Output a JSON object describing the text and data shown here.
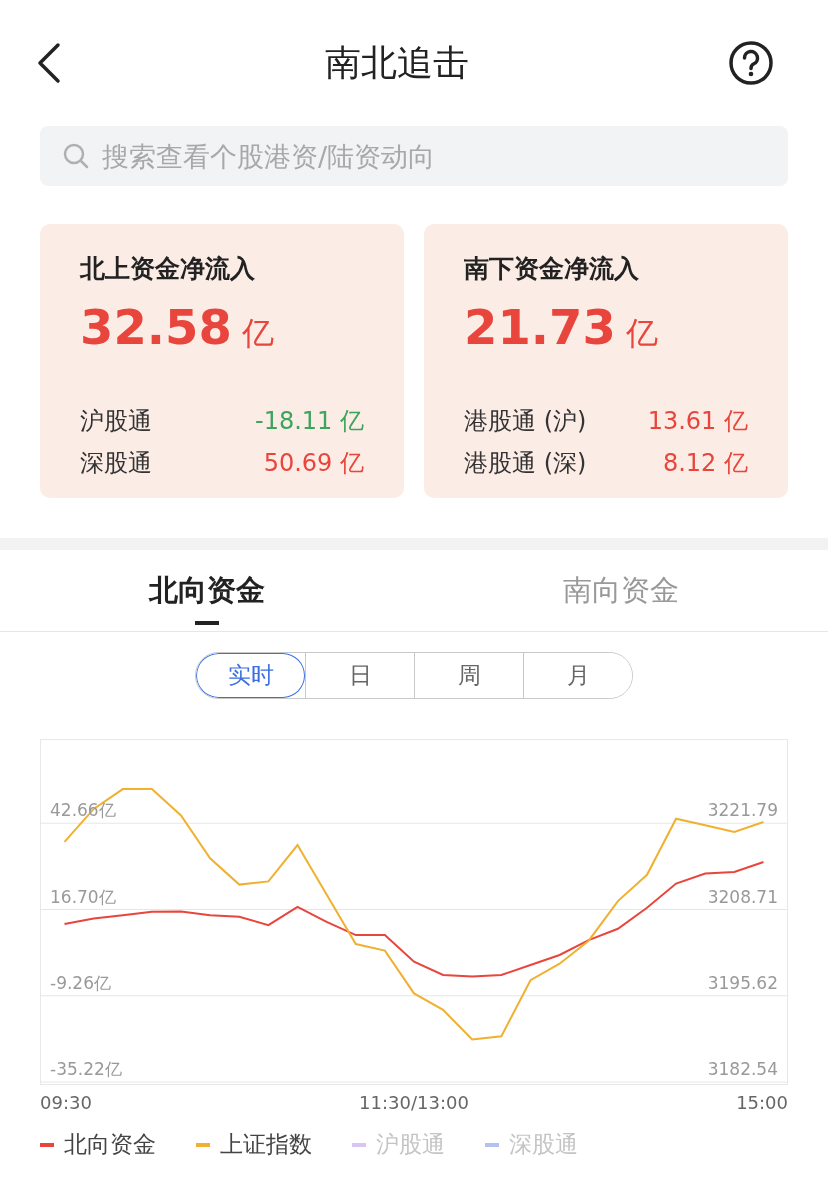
{
  "header": {
    "title": "南北追击"
  },
  "search": {
    "placeholder": "搜索查看个股港资/陆资动向"
  },
  "cards": [
    {
      "title": "北上资金净流入",
      "amount": "32.58",
      "unit": "亿",
      "rows": [
        {
          "label": "沪股通",
          "value": "-18.11 亿",
          "color": "#3aa55b"
        },
        {
          "label": "深股通",
          "value": "50.69 亿",
          "color": "#e8453c"
        }
      ]
    },
    {
      "title": "南下资金净流入",
      "amount": "21.73",
      "unit": "亿",
      "rows": [
        {
          "label": "港股通 (沪)",
          "value": "13.61 亿",
          "color": "#e8453c"
        },
        {
          "label": "港股通 (深)",
          "value": "8.12 亿",
          "color": "#e8453c"
        }
      ]
    }
  ],
  "tabs": [
    {
      "label": "北向资金",
      "selected": true
    },
    {
      "label": "南向资金",
      "selected": false
    }
  ],
  "periods": [
    {
      "label": "实时",
      "selected": true
    },
    {
      "label": "日",
      "selected": false
    },
    {
      "label": "周",
      "selected": false
    },
    {
      "label": "月",
      "selected": false
    }
  ],
  "chart_data": {
    "type": "line",
    "categories": [
      "09:30",
      null,
      null,
      null,
      null,
      null,
      null,
      null,
      null,
      null,
      null,
      null,
      "11:30/13:00",
      null,
      null,
      null,
      null,
      null,
      null,
      null,
      null,
      null,
      null,
      null,
      "15:00"
    ],
    "ylim": [
      -36.1,
      68
    ],
    "yticks": [
      {
        "value": -35.22,
        "label": "-35.22亿"
      },
      {
        "value": -9.26,
        "label": "-9.26亿"
      },
      {
        "value": 16.7,
        "label": "16.70亿"
      },
      {
        "value": 42.66,
        "label": "42.66亿"
      }
    ],
    "y2lim": [
      3182.1,
      3234.6
    ],
    "y2ticks": [
      {
        "value": 3182.54,
        "label": "3182.54"
      },
      {
        "value": 3195.62,
        "label": "3195.62"
      },
      {
        "value": 3208.71,
        "label": "3208.71"
      },
      {
        "value": 3221.79,
        "label": "3221.79"
      }
    ],
    "series": [
      {
        "name": "北向资金",
        "color": "#e8453c",
        "values": [
          12.3,
          14,
          15,
          16,
          16.1,
          15,
          14.5,
          12,
          17.5,
          13,
          9,
          9,
          1,
          -3,
          -3.5,
          -3,
          0,
          3,
          7.5,
          10.9,
          17.2,
          24.5,
          27.5,
          28,
          31
        ]
      },
      {
        "name": "上证指数",
        "color": "#f0b030",
        "axis": "y2",
        "values": [
          3219,
          3224,
          3227,
          3227,
          3223,
          3216.5,
          3212.5,
          3213,
          3218.5,
          3211,
          3203.5,
          3202.5,
          3196,
          3193.5,
          3189,
          3189.5,
          3198,
          3200.5,
          3204,
          3210,
          3214,
          3222.5,
          3221.5,
          3220.5,
          3222
        ]
      }
    ],
    "grid": true
  },
  "hidden_series": [
    {
      "name": "沪股通",
      "color": "#d9c4f2"
    },
    {
      "name": "深股通",
      "color": "#b4c2f2"
    }
  ]
}
